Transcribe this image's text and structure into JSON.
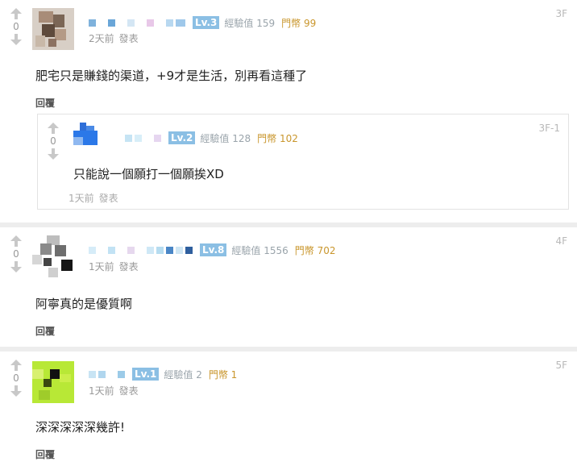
{
  "comments": [
    {
      "vote_count": "0",
      "level": "Lv.3",
      "exp": "經驗值 159",
      "coin": "門幣 99",
      "time": "2天前",
      "post_label": "發表",
      "floor": "3F",
      "body": "肥宅只是賺錢的渠道，+9才是生活，別再看這種了",
      "reply_label": "回覆",
      "sub": {
        "vote_count": "0",
        "level": "Lv.2",
        "exp": "經驗值 128",
        "coin": "門幣 102",
        "floor": "3F-1",
        "body": "只能說一個願打一個願挨XD",
        "time": "1天前",
        "post_label": "發表"
      }
    },
    {
      "vote_count": "0",
      "level": "Lv.8",
      "exp": "經驗值 1556",
      "coin": "門幣 702",
      "time": "1天前",
      "post_label": "發表",
      "floor": "4F",
      "body": "阿寧真的是優質啊",
      "reply_label": "回覆"
    },
    {
      "vote_count": "0",
      "level": "Lv.1",
      "exp": "經驗值 2",
      "coin": "門幣 1",
      "time": "1天前",
      "post_label": "發表",
      "floor": "5F",
      "body": "深深深深深幾許!",
      "reply_label": "回覆"
    }
  ],
  "icons": {
    "upvote": "arrow-up-icon",
    "downvote": "arrow-down-icon"
  },
  "colors": {
    "level_badge": "#8bbfe4",
    "coin_text": "#c9962c",
    "exp_text": "#9aa4ab"
  }
}
